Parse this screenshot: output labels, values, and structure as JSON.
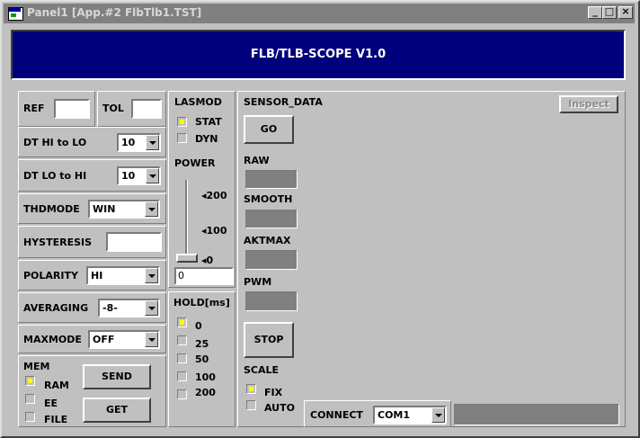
{
  "window": {
    "title": "Panel1 [App.#2 FlbTlb1.TST]"
  },
  "banner": {
    "title": "FLB/TLB-SCOPE V1.0"
  },
  "left": {
    "ref_label": "REF",
    "ref_value": "",
    "tol_label": "TOL",
    "tol_value": "",
    "dt_hi_lo_label": "DT  HI to LO",
    "dt_hi_lo_value": "10",
    "dt_lo_hi_label": "DT  LO to HI",
    "dt_lo_hi_value": "10",
    "thdmode_label": "THDMODE",
    "thdmode_value": "WIN",
    "hysteresis_label": "HYSTERESIS",
    "hysteresis_value": "",
    "polarity_label": "POLARITY",
    "polarity_value": "HI",
    "averaging_label": "AVERAGING",
    "averaging_value": "-8-",
    "maxmode_label": "MAXMODE",
    "maxmode_value": "OFF",
    "mem_label": "MEM",
    "mem_options": [
      "RAM",
      "EE",
      "FILE"
    ],
    "send_label": "SEND",
    "get_label": "GET"
  },
  "middle": {
    "lasmod_label": "LASMOD",
    "lasmod_options": [
      "STAT",
      "DYN"
    ],
    "power_label": "POWER",
    "power_ticks": [
      "200",
      "100",
      "0"
    ],
    "power_value": "0",
    "hold_label": "HOLD[ms]",
    "hold_options": [
      "0",
      "25",
      "50",
      "100",
      "200"
    ]
  },
  "right": {
    "sensor_data_label": "SENSOR_DATA",
    "inspect_label": "Inspect",
    "go_label": "GO",
    "raw_label": "RAW",
    "smooth_label": "SMOOTH",
    "aktmax_label": "AKTMAX",
    "pwm_label": "PWM",
    "stop_label": "STOP",
    "scale_label": "SCALE",
    "scale_options": [
      "FIX",
      "AUTO"
    ],
    "connect_label": "CONNECT",
    "connect_value": "COM1"
  },
  "colors": {
    "banner_bg": "#00007c",
    "led_on": "#ffff00",
    "face": "#c0c0c0"
  }
}
